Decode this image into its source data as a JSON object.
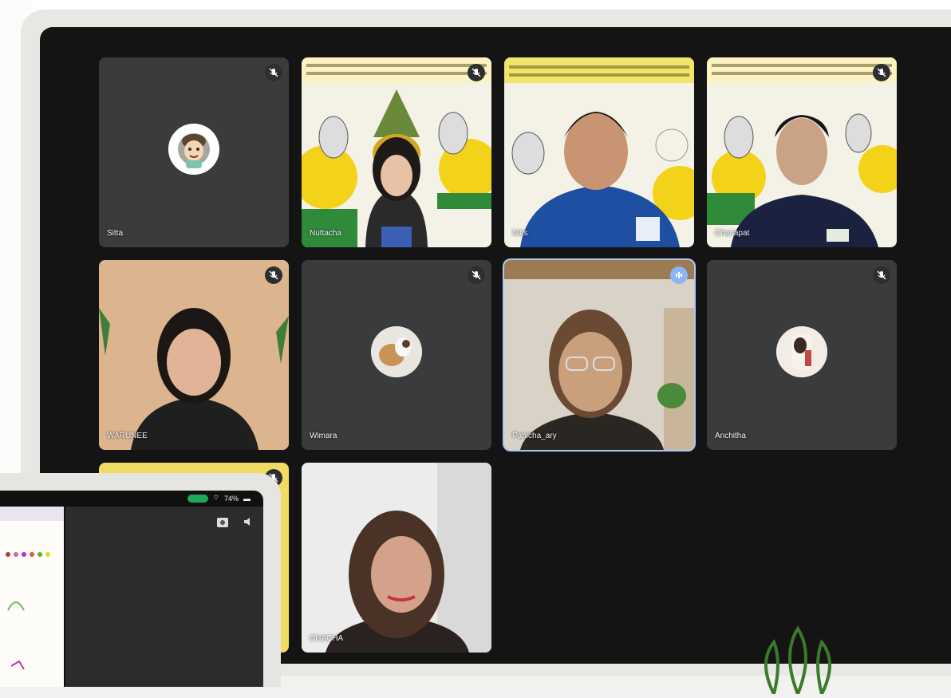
{
  "meeting": {
    "participants": [
      {
        "name": "Sitta",
        "video": "avatar",
        "mic": "muted",
        "icon": "mic-off-icon"
      },
      {
        "name": "Nuttacha",
        "video": "camera",
        "mic": "muted",
        "icon": "mic-off-icon"
      },
      {
        "name": "Nitis",
        "video": "camera",
        "mic": "on"
      },
      {
        "name": "Chanapat",
        "video": "camera",
        "mic": "muted",
        "icon": "mic-off-icon"
      },
      {
        "name": "WARUNEE",
        "video": "camera",
        "mic": "muted",
        "icon": "mic-off-icon"
      },
      {
        "name": "Wimara",
        "video": "avatar",
        "mic": "muted",
        "icon": "mic-off-icon"
      },
      {
        "name": "Panicha_ary",
        "video": "camera",
        "mic": "speaking",
        "icon": "speaking-icon",
        "active": true
      },
      {
        "name": "Anchitha",
        "video": "avatar",
        "mic": "muted",
        "icon": "mic-off-icon"
      },
      {
        "name": "",
        "video": "camera",
        "mic": "muted",
        "icon": "mic-off-icon"
      },
      {
        "name": "CHACHA",
        "video": "camera",
        "mic": "on"
      }
    ]
  },
  "phone": {
    "status": "74%"
  },
  "colors": {
    "screen_bg": "#141414",
    "tile_bg": "#3a3b3d",
    "active_border": "#aec6f5",
    "speaking": "#8ab4f8",
    "battery_pill": "#1ea85a"
  }
}
